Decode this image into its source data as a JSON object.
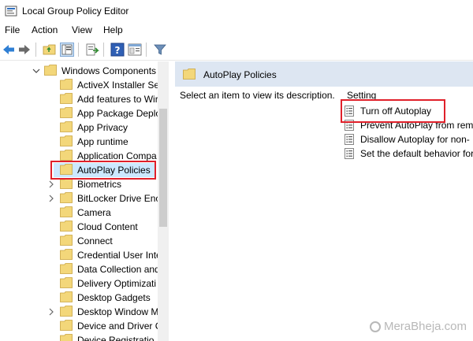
{
  "window": {
    "title": "Local Group Policy Editor"
  },
  "menu": [
    "File",
    "Action",
    "View",
    "Help"
  ],
  "tree": {
    "parent": "Windows Components",
    "items": [
      {
        "label": "ActiveX Installer Ser",
        "expandable": false
      },
      {
        "label": "Add features to Wir",
        "expandable": false
      },
      {
        "label": "App Package Deplo",
        "expandable": false
      },
      {
        "label": "App Privacy",
        "expandable": false
      },
      {
        "label": "App runtime",
        "expandable": false
      },
      {
        "label": "Application Compa",
        "expandable": false
      },
      {
        "label": "AutoPlay Policies",
        "expandable": false,
        "selected": true
      },
      {
        "label": "Biometrics",
        "expandable": true
      },
      {
        "label": "BitLocker Drive Enc",
        "expandable": true
      },
      {
        "label": "Camera",
        "expandable": false
      },
      {
        "label": "Cloud Content",
        "expandable": false
      },
      {
        "label": "Connect",
        "expandable": false
      },
      {
        "label": "Credential User Inte",
        "expandable": false
      },
      {
        "label": "Data Collection and",
        "expandable": false
      },
      {
        "label": "Delivery Optimizati",
        "expandable": false
      },
      {
        "label": "Desktop Gadgets",
        "expandable": false
      },
      {
        "label": "Desktop Window M",
        "expandable": true
      },
      {
        "label": "Device and Driver C",
        "expandable": false
      },
      {
        "label": "Device Registratio",
        "expandable": false
      }
    ]
  },
  "right_pane": {
    "header": "AutoPlay Policies",
    "description": "Select an item to view its description.",
    "column": "Setting",
    "settings": [
      "Turn off Autoplay",
      "Prevent AutoPlay from rem",
      "Disallow Autoplay for non-",
      "Set the default behavior for"
    ]
  },
  "watermark": "MeraBheja.com",
  "colors": {
    "selection": "#cce8ff",
    "highlight_box": "#e0202a",
    "header_band": "#dde6f2",
    "folder": "#f3d77a"
  }
}
